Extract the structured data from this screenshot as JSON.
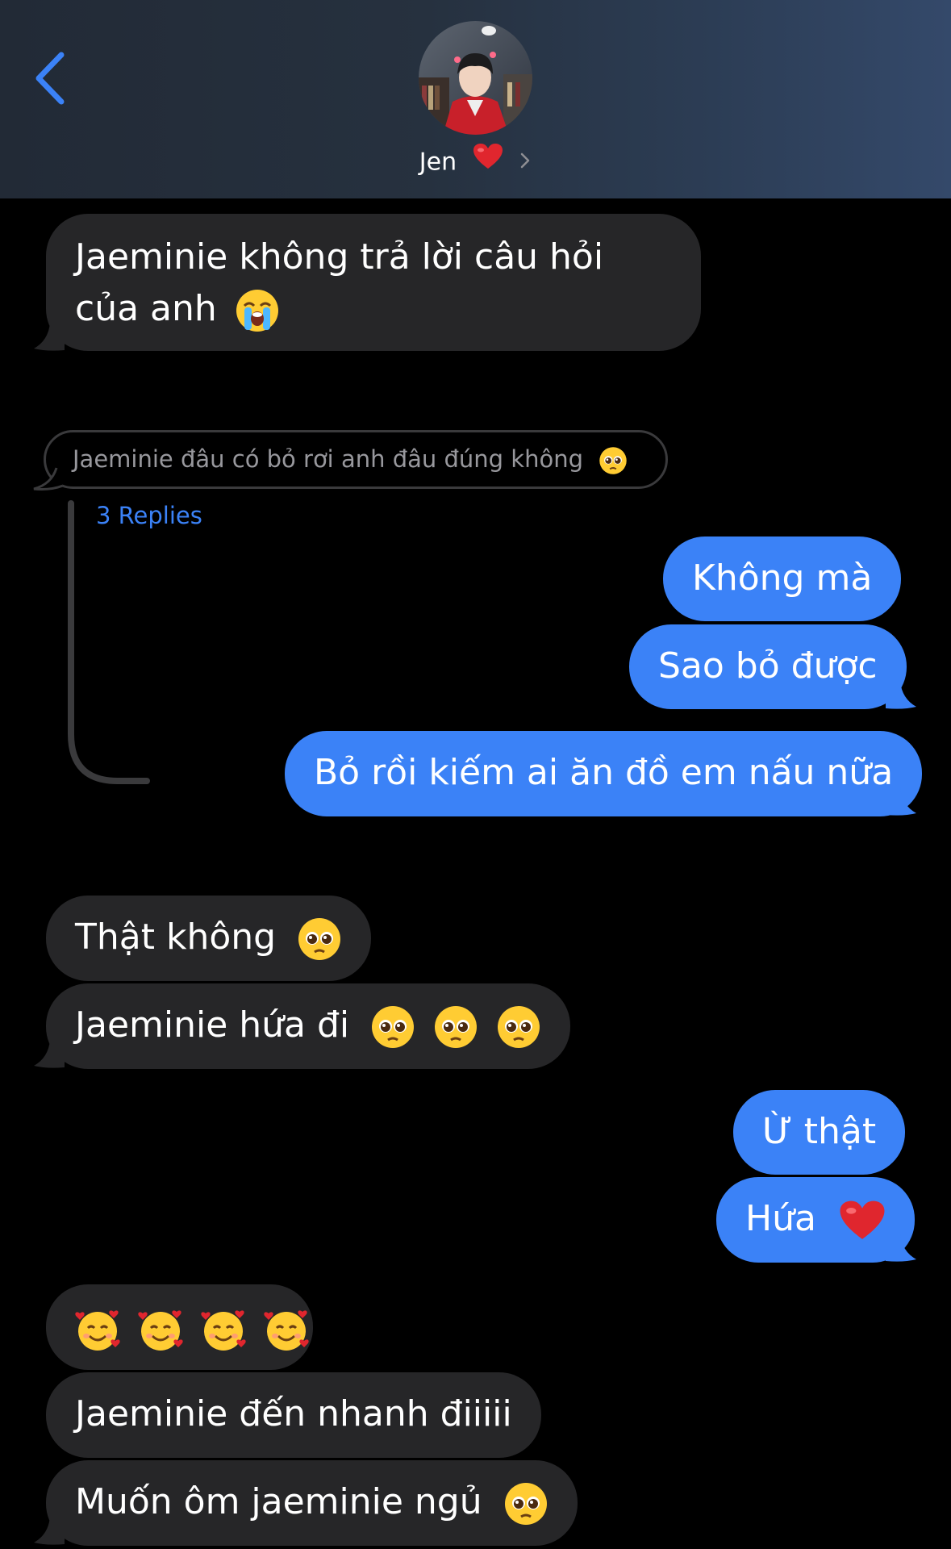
{
  "header": {
    "contact_name": "Jen",
    "heart": "red-heart",
    "colors": {
      "accent": "#3b82f7",
      "incoming": "#262628",
      "outgoing": "#3b82f7",
      "reply_link": "#3b82f7"
    }
  },
  "messages": [
    {
      "side": "in",
      "text": "Jaeminie không trả lời câu hỏi của anh",
      "emojis": [
        "loudly-crying-face"
      ]
    },
    {
      "side": "thread-preview",
      "text": "Jaeminie đâu có bỏ rơi anh đâu đúng không",
      "emojis": [
        "pleading-face"
      ]
    },
    {
      "side": "out",
      "text": "Không mà",
      "emojis": []
    },
    {
      "side": "out",
      "text": "Sao bỏ được",
      "emojis": []
    },
    {
      "side": "out",
      "text": "Bỏ rồi kiếm ai ăn đồ em nấu nữa",
      "emojis": []
    },
    {
      "side": "in",
      "text": "Thật không",
      "emojis": [
        "pleading-face"
      ]
    },
    {
      "side": "in",
      "text": "Jaeminie hứa đi",
      "emojis": [
        "pleading-face",
        "pleading-face",
        "pleading-face"
      ]
    },
    {
      "side": "out",
      "text": "Ừ thật",
      "emojis": []
    },
    {
      "side": "out",
      "text": "Hứa",
      "emojis": [
        "red-heart"
      ]
    },
    {
      "side": "in",
      "text": "",
      "emojis": [
        "smiling-face-with-hearts",
        "smiling-face-with-hearts",
        "smiling-face-with-hearts",
        "smiling-face-with-hearts"
      ]
    },
    {
      "side": "in",
      "text": "Jaeminie đến nhanh điiiii",
      "emojis": []
    },
    {
      "side": "in",
      "text": "Muốn ôm jaeminie ngủ",
      "emojis": [
        "pleading-face"
      ]
    }
  ],
  "thread": {
    "replies_label": "3 Replies"
  }
}
